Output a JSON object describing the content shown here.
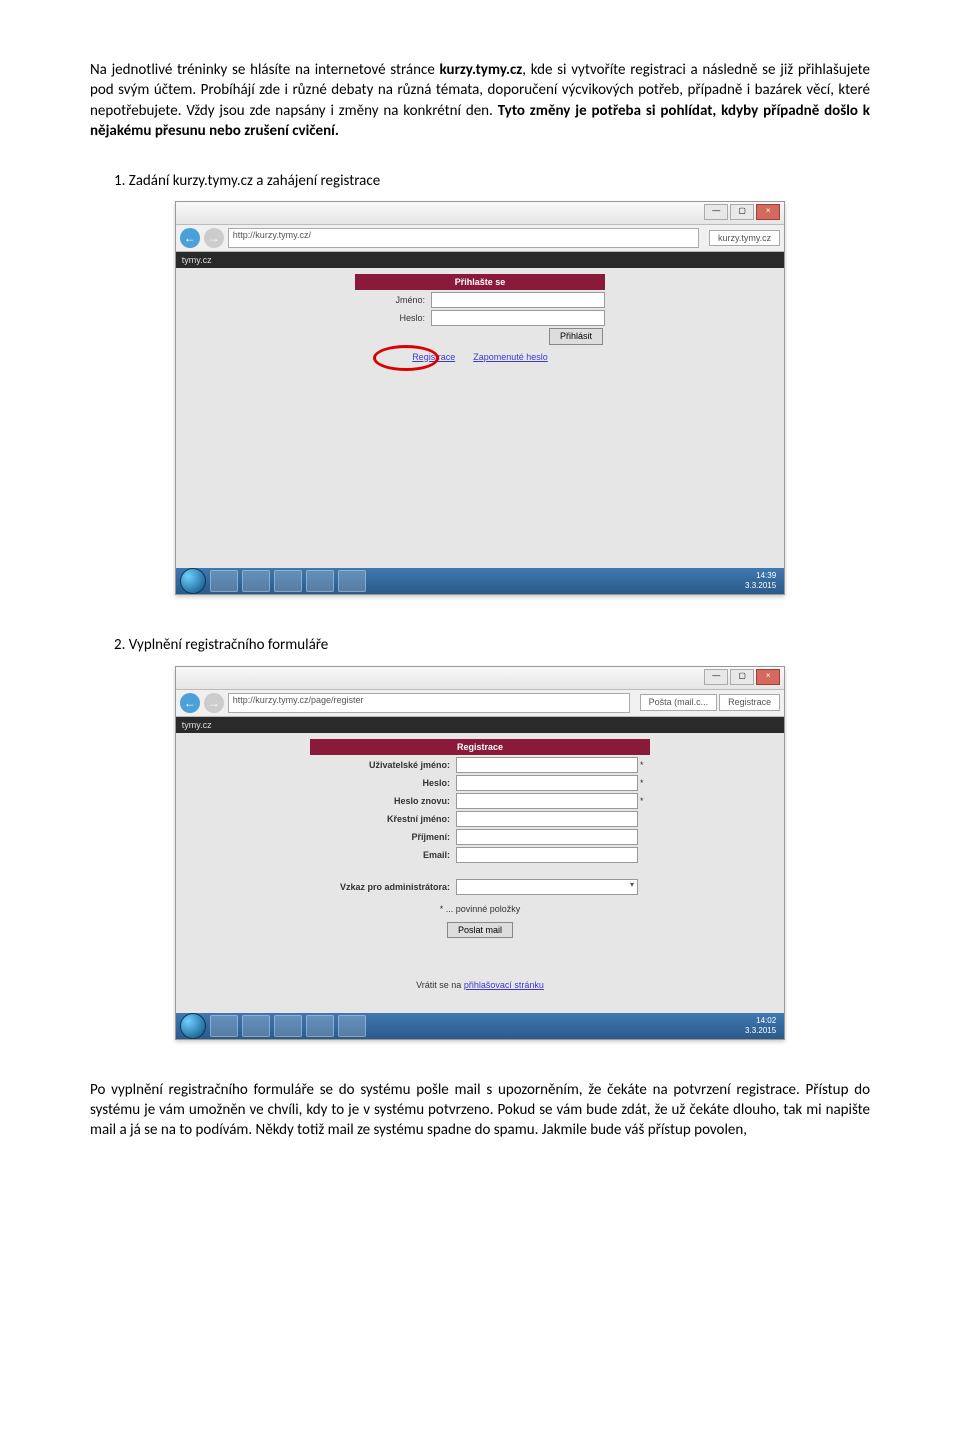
{
  "para1": {
    "t1": "Na jednotlivé tréninky se hlásíte na internetové stránce ",
    "b1": "kurzy.tymy.cz",
    "t2": ", kde si vytvoříte registraci a následně se již přihlašujete pod svým účtem. Probíhájí zde i různé debaty na různá témata, doporučení výcvikových potřeb, případně i bazárek věcí, které nepotřebujete. Vždy jsou zde napsány i změny na konkrétní den. ",
    "b2": "Tyto změny je potřeba si pohlídat, kdyby případně došlo k nějakému přesunu nebo zrušení cvičení."
  },
  "step1": "1.  Zadání kurzy.tymy.cz a zahájení registrace",
  "step2": "2.  Vyplnění registračního formuláře",
  "para2": "Po vyplnění registračního formuláře se do systému pošle mail s upozorněním, že čekáte na potvrzení registrace. Přístup do systému je vám umožněn ve chvíli, kdy to je v systému potvrzeno. Pokud se vám bude zdát, že už čekáte dlouho, tak mi napište mail a já se na to podívám. Někdy totiž mail ze systému spadne do spamu. Jakmile bude váš přístup povolen,",
  "shot1": {
    "url": "http://kurzy.tymy.cz/",
    "tab": "kurzy.tymy.cz",
    "brand": "tymy.cz",
    "head": "Přihlašte se",
    "userLbl": "Jméno:",
    "passLbl": "Heslo:",
    "btn": "Přihlásit",
    "link1": "Registrace",
    "link2": "Zapomenuté heslo",
    "time1": "14:39",
    "time2": "3.3.2015"
  },
  "shot2": {
    "url": "http://kurzy.tymy.cz/page/register",
    "tab1": "Pošta (mail.c...",
    "tab2": "Registrace",
    "brand": "tymy.cz",
    "head": "Registrace",
    "f1": "Uživatelské jméno:",
    "f2": "Heslo:",
    "f3": "Heslo znovu:",
    "f4": "Křestní jméno:",
    "f5": "Příjmení:",
    "f6": "Email:",
    "f7": "Vzkaz pro administrátora:",
    "note": "* ... povinné položky",
    "btn": "Poslat mail",
    "backPre": "Vrátit se na ",
    "backLink": "přihlašovací stránku",
    "time1": "14:02",
    "time2": "3.3.2015"
  }
}
